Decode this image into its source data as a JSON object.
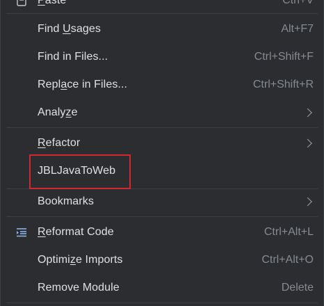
{
  "menu": {
    "items": [
      {
        "id": "paste",
        "label_pre": "",
        "mnemonic": "P",
        "label_post": "aste",
        "shortcut": "Ctrl+V",
        "icon": "paste-icon"
      },
      {
        "id": "find-usages",
        "label_pre": "Find ",
        "mnemonic": "U",
        "label_post": "sages",
        "shortcut": "Alt+F7"
      },
      {
        "id": "find-in-files",
        "label_pre": "Find in Files...",
        "mnemonic": "",
        "label_post": "",
        "shortcut": "Ctrl+Shift+F"
      },
      {
        "id": "replace-in-files",
        "label_pre": "Repl",
        "mnemonic": "a",
        "label_post": "ce in Files...",
        "shortcut": "Ctrl+Shift+R"
      },
      {
        "id": "analyze",
        "label_pre": "Analy",
        "mnemonic": "z",
        "label_post": "e",
        "submenu": true
      },
      {
        "id": "refactor",
        "label_pre": "",
        "mnemonic": "R",
        "label_post": "efactor",
        "submenu": true
      },
      {
        "id": "jbl-java-to-web",
        "label_pre": "JBLJavaToWeb",
        "mnemonic": "",
        "label_post": ""
      },
      {
        "id": "bookmarks",
        "label_pre": "Bookmarks",
        "mnemonic": "",
        "label_post": "",
        "submenu": true
      },
      {
        "id": "reformat-code",
        "label_pre": "",
        "mnemonic": "R",
        "label_post": "eformat Code",
        "shortcut": "Ctrl+Alt+L",
        "icon": "reformat-icon"
      },
      {
        "id": "optimize-imports",
        "label_pre": "Optimi",
        "mnemonic": "z",
        "label_post": "e Imports",
        "shortcut": "Ctrl+Alt+O"
      },
      {
        "id": "remove-module",
        "label_pre": "Remove Module",
        "mnemonic": "",
        "label_post": "",
        "shortcut": "Delete"
      }
    ]
  },
  "colors": {
    "background": "#2b2d30",
    "text": "#dfe1e5",
    "shortcut": "#868a91",
    "separator": "#3d4044",
    "highlight": "#d3262e"
  }
}
